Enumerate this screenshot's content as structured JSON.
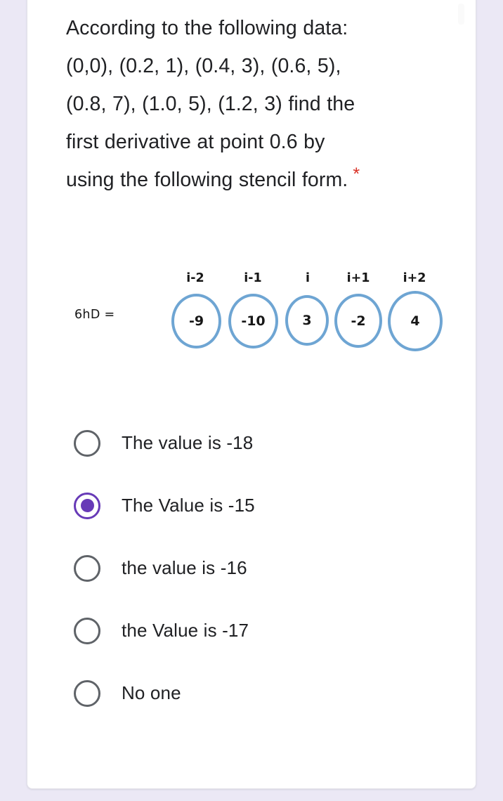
{
  "question": {
    "text": "According to the following data: (0,0), (0.2, 1), (0.4, 3), (0.6, 5), (0.8, 7), (1.0, 5), (1.2, 3) find the first derivative at point 0.6 by using the following stencil form.",
    "required_marker": "*"
  },
  "stencil": {
    "lhs_label": "6hD =",
    "index_labels": [
      "i-2",
      "i-1",
      "i",
      "i+1",
      "i+2"
    ],
    "coefficients": [
      "-9",
      "-10",
      "3",
      "-2",
      "4"
    ],
    "circle_color": "#6ea5d3"
  },
  "options": [
    {
      "label": "The value is -18",
      "selected": false
    },
    {
      "label": "The Value is -15",
      "selected": true
    },
    {
      "label": "the value is -16",
      "selected": false
    },
    {
      "label": "the Value is -17",
      "selected": false
    },
    {
      "label": "No one",
      "selected": false
    }
  ],
  "colors": {
    "page_background": "#ebe8f5",
    "card_background": "#ffffff",
    "accent_selected": "#673ab7",
    "radio_unselected": "#5f6368",
    "required_red": "#d93025",
    "text": "#202124"
  }
}
